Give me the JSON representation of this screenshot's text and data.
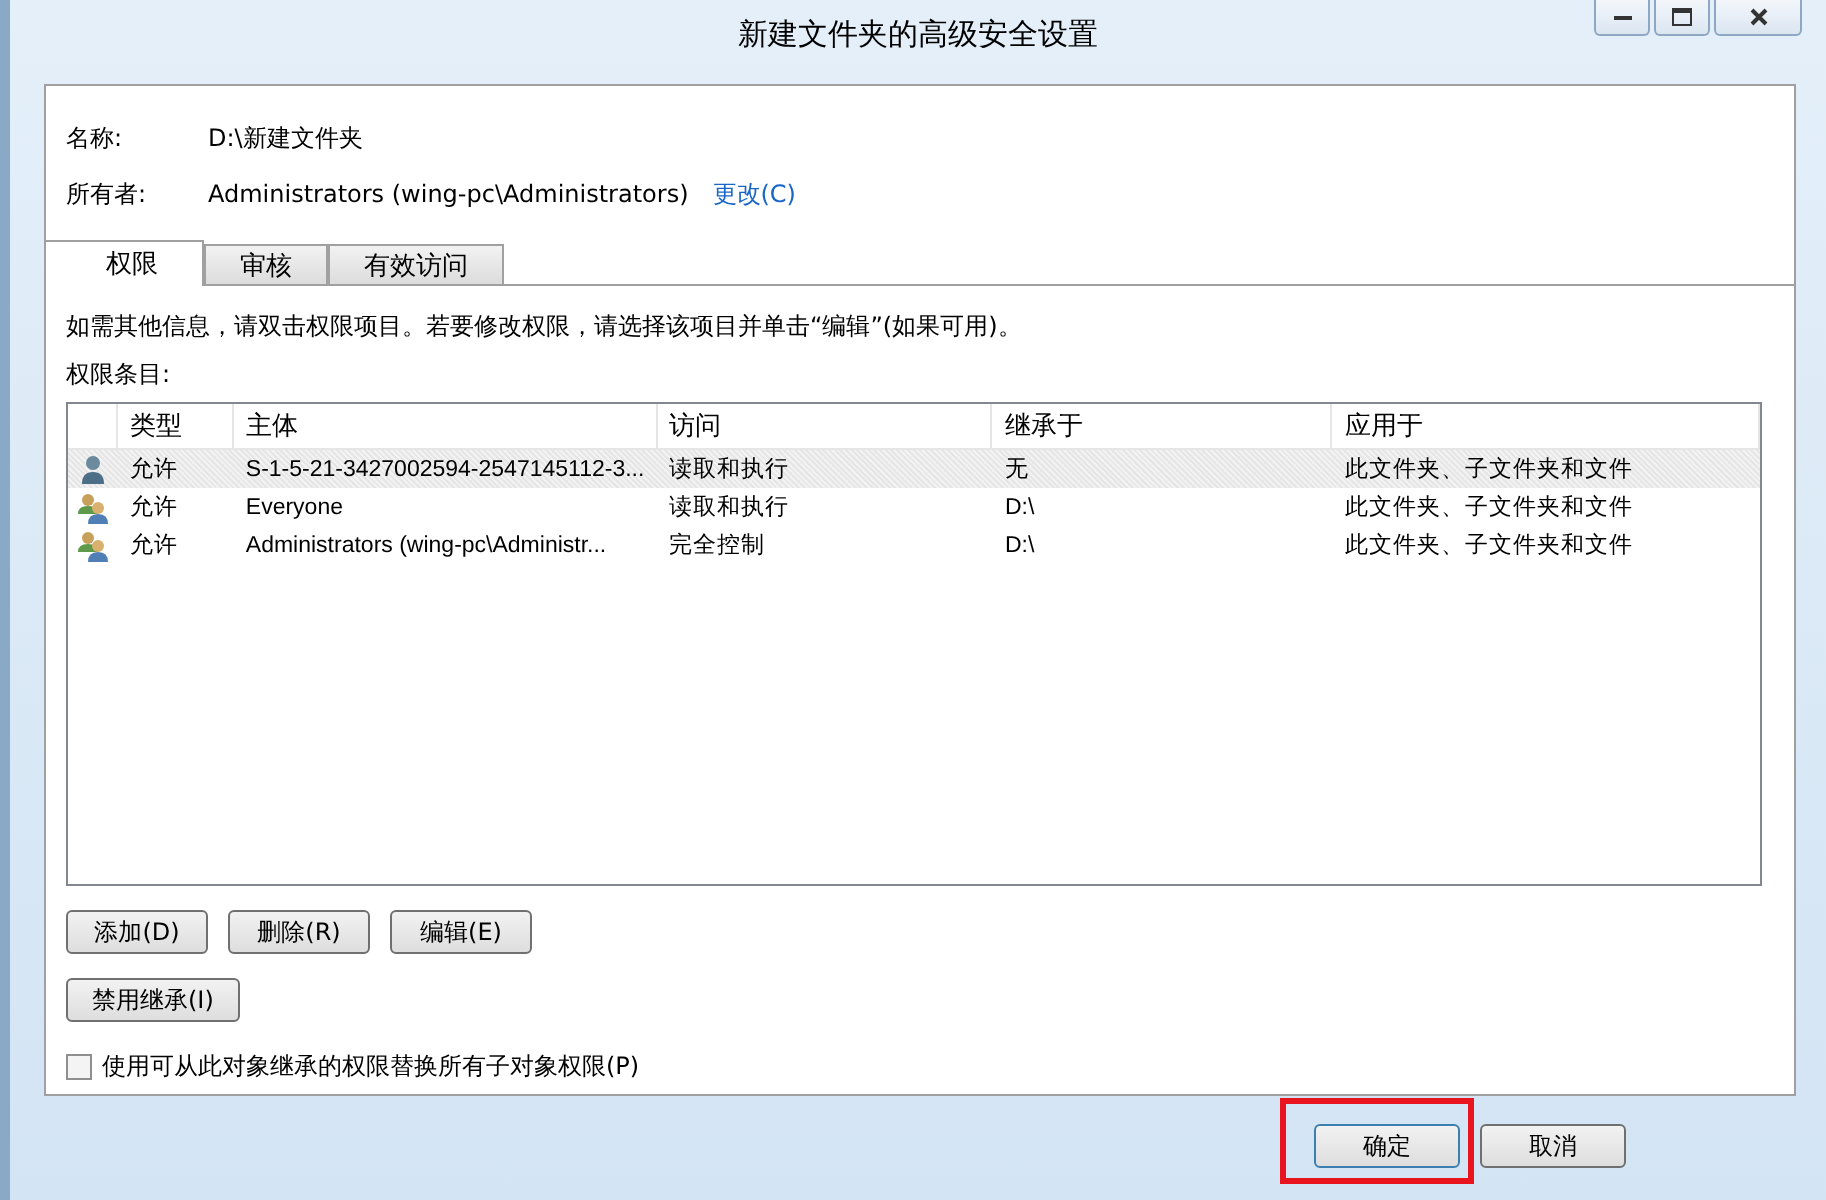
{
  "window": {
    "title": "新建文件夹的高级安全设置"
  },
  "name": {
    "label": "名称:",
    "value": "D:\\新建文件夹"
  },
  "owner": {
    "label": "所有者:",
    "value": "Administrators (wing-pc\\Administrators)",
    "link": "更改(C)"
  },
  "tabs": [
    {
      "label": "权限",
      "selected": true
    },
    {
      "label": "审核",
      "selected": false
    },
    {
      "label": "有效访问",
      "selected": false
    }
  ],
  "info": "如需其他信息，请双击权限项目。若要修改权限，请选择该项目并单击“编辑”(如果可用)。",
  "entries_label": "权限条目:",
  "table": {
    "columns": [
      "类型",
      "主体",
      "访问",
      "继承于",
      "应用于"
    ],
    "rows": [
      {
        "kind": "user",
        "cells": [
          "允许",
          "S-1-5-21-3427002594-2547145112-3...",
          "读取和执行",
          "无",
          "此文件夹、子文件夹和文件"
        ],
        "selected": true
      },
      {
        "kind": "group",
        "cells": [
          "允许",
          "Everyone",
          "读取和执行",
          "D:\\",
          "此文件夹、子文件夹和文件"
        ],
        "selected": false
      },
      {
        "kind": "group",
        "cells": [
          "允许",
          "Administrators (wing-pc\\Administr...",
          "完全控制",
          "D:\\",
          "此文件夹、子文件夹和文件"
        ],
        "selected": false
      }
    ]
  },
  "entry_buttons": [
    "添加(D)",
    "删除(R)",
    "编辑(E)"
  ],
  "inheritance_button": "禁用继承(I)",
  "replace_checkbox": {
    "label": "使用可从此对象继承的权限替换所有子对象权限(P)",
    "checked": false
  },
  "footer_buttons": [
    {
      "label": "确定",
      "highlighted": true
    },
    {
      "label": "取消",
      "highlighted": false
    }
  ]
}
